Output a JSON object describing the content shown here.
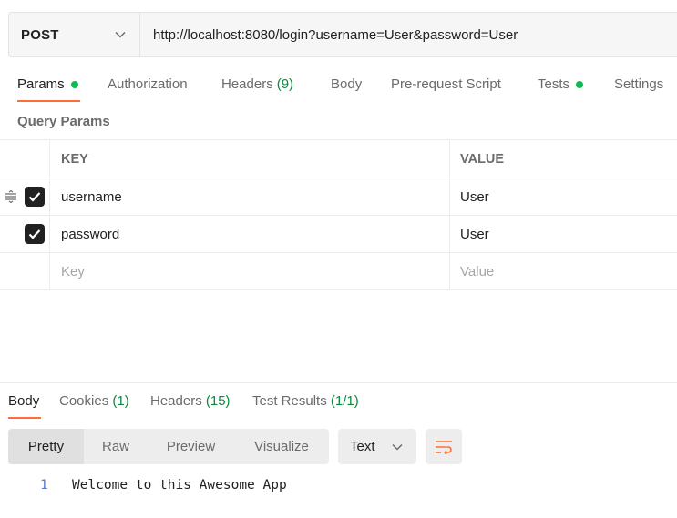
{
  "request": {
    "method": "POST",
    "url": "http://localhost:8080/login?username=User&password=User"
  },
  "request_tabs": [
    {
      "label": "Params",
      "count": "",
      "dot": true,
      "active": true
    },
    {
      "label": "Authorization",
      "count": "",
      "dot": false,
      "active": false
    },
    {
      "label": "Headers",
      "count": "(9)",
      "dot": false,
      "active": false
    },
    {
      "label": "Body",
      "count": "",
      "dot": false,
      "active": false
    },
    {
      "label": "Pre-request Script",
      "count": "",
      "dot": false,
      "active": false
    },
    {
      "label": "Tests",
      "count": "",
      "dot": true,
      "active": false
    },
    {
      "label": "Settings",
      "count": "",
      "dot": false,
      "active": false
    }
  ],
  "query_params": {
    "title": "Query Params",
    "columns": {
      "key": "KEY",
      "value": "VALUE"
    },
    "rows": [
      {
        "key": "username",
        "value": "User",
        "checked": true
      },
      {
        "key": "password",
        "value": "User",
        "checked": true
      }
    ],
    "placeholder": {
      "key": "Key",
      "value": "Value"
    }
  },
  "response_tabs": [
    {
      "label": "Body",
      "count": "",
      "active": true
    },
    {
      "label": "Cookies",
      "count": "(1)",
      "active": false
    },
    {
      "label": "Headers",
      "count": "(15)",
      "active": false
    },
    {
      "label": "Test Results",
      "count": "(1/1)",
      "active": false
    }
  ],
  "view_modes": [
    "Pretty",
    "Raw",
    "Preview",
    "Visualize"
  ],
  "format": "Text",
  "response_body": {
    "line_number": "1",
    "text": "Welcome to this Awesome App"
  },
  "colors": {
    "accent": "#ff6c37",
    "status_green": "#0cbb52",
    "count_green": "#0b8a3d"
  }
}
